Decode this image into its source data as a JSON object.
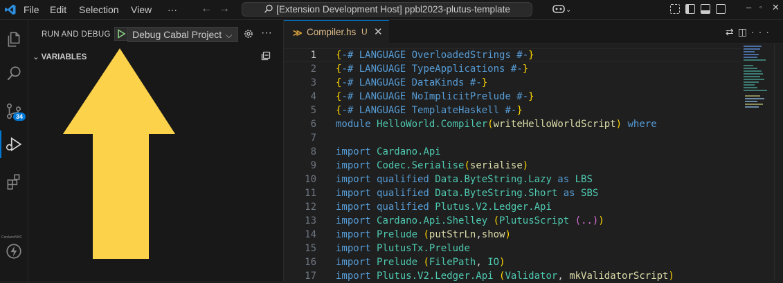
{
  "menu": {
    "file": "File",
    "edit": "Edit",
    "selection": "Selection",
    "view": "View",
    "more": "···"
  },
  "command_center": {
    "text": "[Extension Development Host] ppbl2023-plutus-template"
  },
  "activity_bar": {
    "source_control_badge": "34",
    "extension_label": "CardanoNNC",
    "colors": {
      "badge": "#0078d4",
      "active_indicator": "#0078d4"
    }
  },
  "sidebar": {
    "title": "RUN AND DEBUG",
    "launch_config": "Debug Cabal Project",
    "variables_header": "VARIABLES"
  },
  "annotation": {
    "arrow_color": "#fbd24a"
  },
  "editor": {
    "tab": {
      "name": "Compiler.hs",
      "status": "U"
    },
    "lines": [
      {
        "n": "1",
        "tokens": [
          {
            "c": "tk-brace",
            "t": "{"
          },
          {
            "c": "tk-prag",
            "t": "-# LANGUAGE OverloadedStrings #-"
          },
          {
            "c": "tk-brace",
            "t": "}"
          }
        ]
      },
      {
        "n": "2",
        "tokens": [
          {
            "c": "tk-brace",
            "t": "{"
          },
          {
            "c": "tk-prag",
            "t": "-# LANGUAGE TypeApplications #-"
          },
          {
            "c": "tk-brace",
            "t": "}"
          }
        ]
      },
      {
        "n": "3",
        "tokens": [
          {
            "c": "tk-brace",
            "t": "{"
          },
          {
            "c": "tk-prag",
            "t": "-# LANGUAGE DataKinds #-"
          },
          {
            "c": "tk-brace",
            "t": "}"
          }
        ]
      },
      {
        "n": "4",
        "tokens": [
          {
            "c": "tk-brace",
            "t": "{"
          },
          {
            "c": "tk-prag",
            "t": "-# LANGUAGE NoImplicitPrelude #-"
          },
          {
            "c": "tk-brace",
            "t": "}"
          }
        ]
      },
      {
        "n": "5",
        "tokens": [
          {
            "c": "tk-brace",
            "t": "{"
          },
          {
            "c": "tk-prag",
            "t": "-# LANGUAGE TemplateHaskell #-"
          },
          {
            "c": "tk-brace",
            "t": "}"
          }
        ]
      },
      {
        "n": "6",
        "tokens": [
          {
            "c": "tk-kw",
            "t": "module "
          },
          {
            "c": "tk-mod",
            "t": "HelloWorld.Compiler"
          },
          {
            "c": "tk-p1",
            "t": "("
          },
          {
            "c": "tk-fn",
            "t": "writeHelloWorldScript"
          },
          {
            "c": "tk-p1",
            "t": ")"
          },
          {
            "c": "tk-kw",
            "t": " where"
          }
        ]
      },
      {
        "n": "7",
        "tokens": []
      },
      {
        "n": "8",
        "tokens": [
          {
            "c": "tk-kw",
            "t": "import "
          },
          {
            "c": "tk-mod",
            "t": "Cardano.Api"
          }
        ]
      },
      {
        "n": "9",
        "tokens": [
          {
            "c": "tk-kw",
            "t": "import "
          },
          {
            "c": "tk-mod",
            "t": "Codec.Serialise"
          },
          {
            "c": "tk-p1",
            "t": "("
          },
          {
            "c": "tk-fn",
            "t": "serialise"
          },
          {
            "c": "tk-p1",
            "t": ")"
          }
        ]
      },
      {
        "n": "10",
        "tokens": [
          {
            "c": "tk-kw",
            "t": "import qualified "
          },
          {
            "c": "tk-mod",
            "t": "Data.ByteString.Lazy"
          },
          {
            "c": "tk-kw",
            "t": " as "
          },
          {
            "c": "tk-mod",
            "t": "LBS"
          }
        ]
      },
      {
        "n": "11",
        "tokens": [
          {
            "c": "tk-kw",
            "t": "import qualified "
          },
          {
            "c": "tk-mod",
            "t": "Data.ByteString.Short"
          },
          {
            "c": "tk-kw",
            "t": " as "
          },
          {
            "c": "tk-mod",
            "t": "SBS"
          }
        ]
      },
      {
        "n": "12",
        "tokens": [
          {
            "c": "tk-kw",
            "t": "import qualified "
          },
          {
            "c": "tk-mod",
            "t": "Plutus.V2.Ledger.Api"
          }
        ]
      },
      {
        "n": "13",
        "tokens": [
          {
            "c": "tk-kw",
            "t": "import "
          },
          {
            "c": "tk-mod",
            "t": "Cardano.Api.Shelley"
          },
          {
            "c": "tk-plain",
            "t": " "
          },
          {
            "c": "tk-p1",
            "t": "("
          },
          {
            "c": "tk-mod",
            "t": "PlutusScript"
          },
          {
            "c": "tk-plain",
            "t": " "
          },
          {
            "c": "tk-p2",
            "t": "(..)"
          },
          {
            "c": "tk-p1",
            "t": ")"
          }
        ]
      },
      {
        "n": "14",
        "tokens": [
          {
            "c": "tk-kw",
            "t": "import "
          },
          {
            "c": "tk-mod",
            "t": "Prelude"
          },
          {
            "c": "tk-plain",
            "t": " "
          },
          {
            "c": "tk-p1",
            "t": "("
          },
          {
            "c": "tk-fn",
            "t": "putStrLn"
          },
          {
            "c": "tk-plain",
            "t": ","
          },
          {
            "c": "tk-fn",
            "t": "show"
          },
          {
            "c": "tk-p1",
            "t": ")"
          }
        ]
      },
      {
        "n": "15",
        "tokens": [
          {
            "c": "tk-kw",
            "t": "import "
          },
          {
            "c": "tk-mod",
            "t": "PlutusTx.Prelude"
          }
        ]
      },
      {
        "n": "16",
        "tokens": [
          {
            "c": "tk-kw",
            "t": "import "
          },
          {
            "c": "tk-mod",
            "t": "Prelude"
          },
          {
            "c": "tk-plain",
            "t": " "
          },
          {
            "c": "tk-p1",
            "t": "("
          },
          {
            "c": "tk-mod",
            "t": "FilePath"
          },
          {
            "c": "tk-plain",
            "t": ", "
          },
          {
            "c": "tk-mod",
            "t": "IO"
          },
          {
            "c": "tk-p1",
            "t": ")"
          }
        ]
      },
      {
        "n": "17",
        "tokens": [
          {
            "c": "tk-kw",
            "t": "import "
          },
          {
            "c": "tk-mod",
            "t": "Plutus.V2.Ledger.Api"
          },
          {
            "c": "tk-plain",
            "t": " "
          },
          {
            "c": "tk-p1",
            "t": "("
          },
          {
            "c": "tk-mod",
            "t": "Validator"
          },
          {
            "c": "tk-plain",
            "t": ", "
          },
          {
            "c": "tk-fn",
            "t": "mkValidatorScript"
          },
          {
            "c": "tk-p1",
            "t": ")"
          }
        ]
      }
    ]
  }
}
